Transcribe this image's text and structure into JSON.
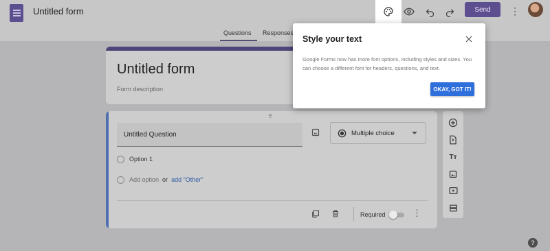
{
  "header": {
    "doc_title": "Untitled form",
    "send_label": "Send",
    "more_symbol": "⋮",
    "icons": [
      "forms-app-icon",
      "palette-icon",
      "eye-icon",
      "undo-icon",
      "redo-icon",
      "more-vert-icon",
      "avatar"
    ],
    "accent_color": "#5d4f8f"
  },
  "tabs": [
    {
      "label": "Questions",
      "active": true
    },
    {
      "label": "Responses",
      "active": false
    }
  ],
  "form": {
    "title": "Untitled form",
    "description_placeholder": "Form description"
  },
  "question": {
    "drag_symbol": "⠿",
    "title": "Untitled Question",
    "type": "Multiple choice",
    "options": [
      "Option 1"
    ],
    "add_option": "Add option",
    "or": "or",
    "add_other": "add \"Other\"",
    "required_label": "Required",
    "required_on": false,
    "more_symbol": "⋮"
  },
  "side_toolbar": {
    "icons": [
      "add-question-icon",
      "import-questions-icon",
      "add-title-icon",
      "add-image-icon",
      "add-video-icon",
      "add-section-icon"
    ],
    "title_glyph": "Tт"
  },
  "dialog": {
    "title": "Style your text",
    "body": "Google Forms now has more font options, including styles and sizes. You can choose a different font for headers, questions, and text.",
    "button": "OKAY, GOT IT!",
    "button_color": "#2f6fdc"
  },
  "help_symbol": "?"
}
